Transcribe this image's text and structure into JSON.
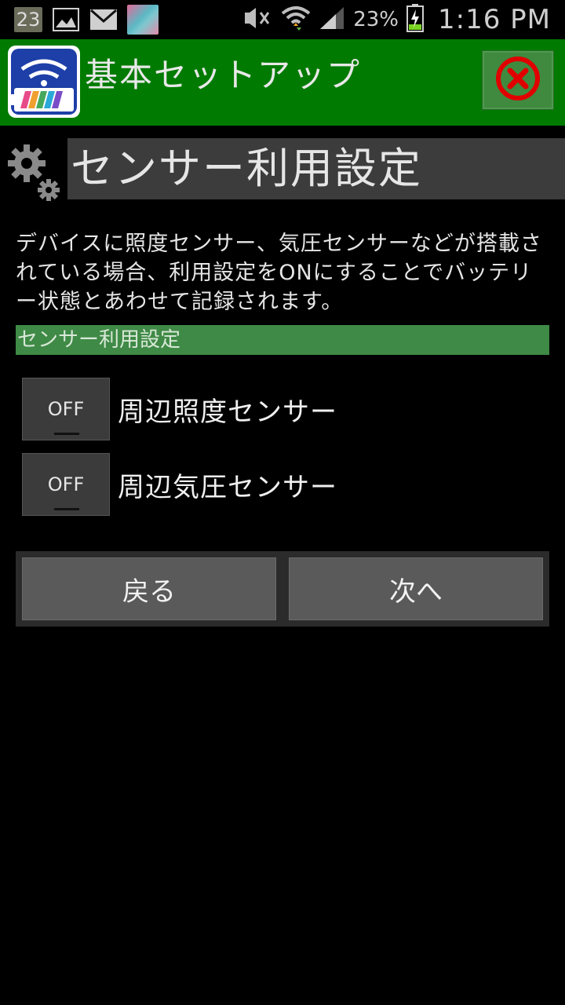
{
  "status_bar": {
    "notification_count": "23",
    "battery_percent": "23%",
    "time": "1:16 PM",
    "icons": [
      "number-badge-icon",
      "image-icon",
      "gmail-icon",
      "app-thumbnail-icon",
      "mute-icon",
      "wifi-icon",
      "signal-icon",
      "battery-charging-icon"
    ]
  },
  "app_bar": {
    "title": "基本セットアップ",
    "close_icon": "close-icon",
    "accent_color": "#007a00"
  },
  "section": {
    "title": "センサー利用設定",
    "icon": "gear-icon"
  },
  "description": "デバイスに照度センサー、気圧センサーなどが搭載されている場合、利用設定をONにすることでバッテリー状態とあわせて記録されます。",
  "group_header": "センサー利用設定",
  "toggles": [
    {
      "state_label": "OFF",
      "label": "周辺照度センサー"
    },
    {
      "state_label": "OFF",
      "label": "周辺気圧センサー"
    }
  ],
  "nav": {
    "back_label": "戻る",
    "next_label": "次へ"
  }
}
